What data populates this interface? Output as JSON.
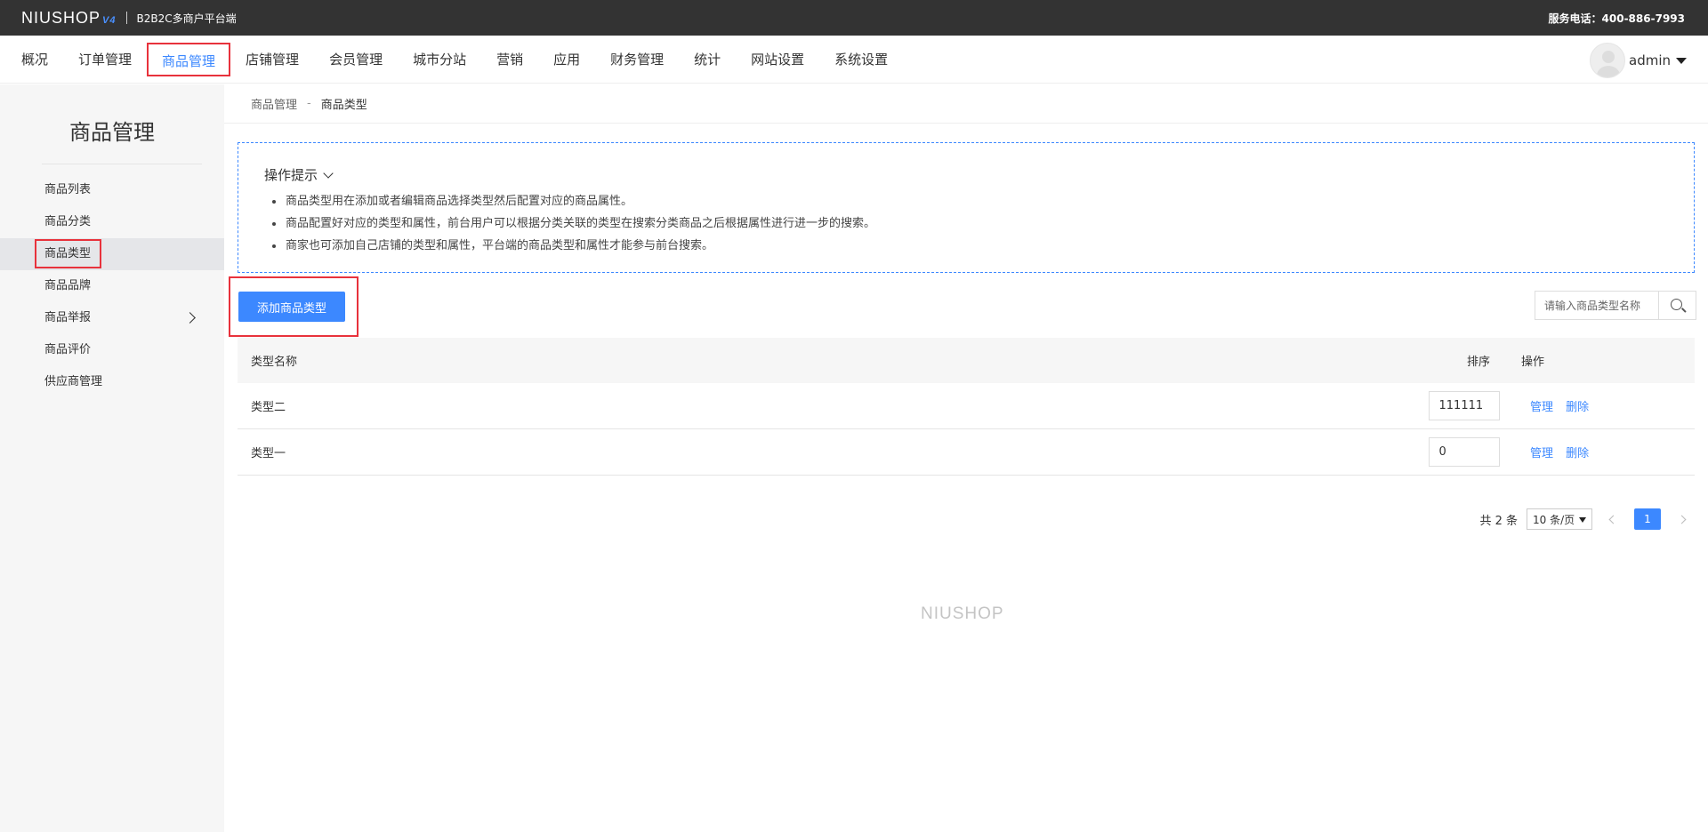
{
  "topbar": {
    "logo": "NIUSHOP",
    "logo_version": "V4",
    "subtitle": "B2B2C多商户平台端",
    "service_phone": "服务电话：400-886-7993"
  },
  "nav": {
    "items": [
      {
        "label": "概况"
      },
      {
        "label": "订单管理"
      },
      {
        "label": "商品管理"
      },
      {
        "label": "店铺管理"
      },
      {
        "label": "会员管理"
      },
      {
        "label": "城市分站"
      },
      {
        "label": "营销"
      },
      {
        "label": "应用"
      },
      {
        "label": "财务管理"
      },
      {
        "label": "统计"
      },
      {
        "label": "网站设置"
      },
      {
        "label": "系统设置"
      }
    ],
    "active_index": 2,
    "user": "admin"
  },
  "sidebar": {
    "title": "商品管理",
    "items": [
      {
        "label": "商品列表"
      },
      {
        "label": "商品分类"
      },
      {
        "label": "商品类型"
      },
      {
        "label": "商品品牌"
      },
      {
        "label": "商品举报"
      },
      {
        "label": "商品评价"
      },
      {
        "label": "供应商管理"
      }
    ]
  },
  "breadcrumb": {
    "parent": "商品管理",
    "separator": "-",
    "current": "商品类型"
  },
  "tips": {
    "title": "操作提示",
    "items": [
      "商品类型用在添加或者编辑商品选择类型然后配置对应的商品属性。",
      "商品配置好对应的类型和属性，前台用户可以根据分类关联的类型在搜索分类商品之后根据属性进行进一步的搜索。",
      "商家也可添加自己店铺的类型和属性，平台端的商品类型和属性才能参与前台搜索。"
    ]
  },
  "toolbar": {
    "add_label": "添加商品类型",
    "search_placeholder": "请输入商品类型名称"
  },
  "table": {
    "headers": {
      "name": "类型名称",
      "sort": "排序",
      "op": "操作"
    },
    "rows": [
      {
        "name": "类型二",
        "sort": "111111",
        "manage": "管理",
        "delete": "删除"
      },
      {
        "name": "类型一",
        "sort": "0",
        "manage": "管理",
        "delete": "删除"
      }
    ]
  },
  "pager": {
    "total": "共 2 条",
    "page_size": "10 条/页",
    "current_page": "1"
  },
  "footer": {
    "logo": "NIUSHOP"
  },
  "colors": {
    "accent": "#3c88ff",
    "highlight": "#e8323c",
    "topbar": "#333333"
  }
}
